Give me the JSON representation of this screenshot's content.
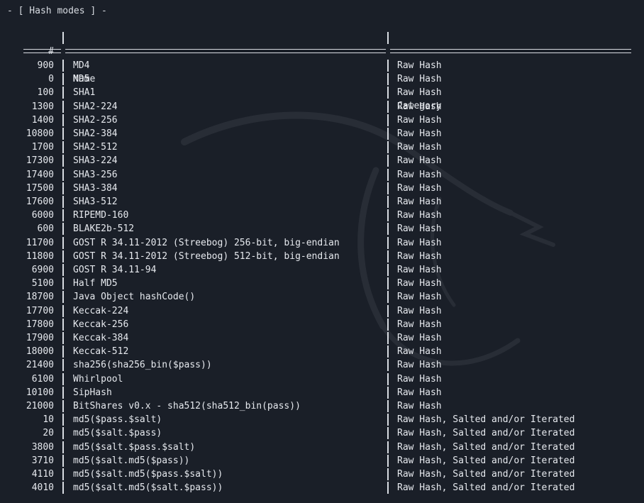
{
  "title": "- [ Hash modes ] -",
  "columns": {
    "num": "#",
    "name": "Name",
    "category": "Category"
  },
  "rows": [
    {
      "num": "900",
      "name": "MD4",
      "category": "Raw Hash"
    },
    {
      "num": "0",
      "name": "MD5",
      "category": "Raw Hash"
    },
    {
      "num": "100",
      "name": "SHA1",
      "category": "Raw Hash"
    },
    {
      "num": "1300",
      "name": "SHA2-224",
      "category": "Raw Hash"
    },
    {
      "num": "1400",
      "name": "SHA2-256",
      "category": "Raw Hash"
    },
    {
      "num": "10800",
      "name": "SHA2-384",
      "category": "Raw Hash"
    },
    {
      "num": "1700",
      "name": "SHA2-512",
      "category": "Raw Hash"
    },
    {
      "num": "17300",
      "name": "SHA3-224",
      "category": "Raw Hash"
    },
    {
      "num": "17400",
      "name": "SHA3-256",
      "category": "Raw Hash"
    },
    {
      "num": "17500",
      "name": "SHA3-384",
      "category": "Raw Hash"
    },
    {
      "num": "17600",
      "name": "SHA3-512",
      "category": "Raw Hash"
    },
    {
      "num": "6000",
      "name": "RIPEMD-160",
      "category": "Raw Hash"
    },
    {
      "num": "600",
      "name": "BLAKE2b-512",
      "category": "Raw Hash"
    },
    {
      "num": "11700",
      "name": "GOST R 34.11-2012 (Streebog) 256-bit, big-endian",
      "category": "Raw Hash"
    },
    {
      "num": "11800",
      "name": "GOST R 34.11-2012 (Streebog) 512-bit, big-endian",
      "category": "Raw Hash"
    },
    {
      "num": "6900",
      "name": "GOST R 34.11-94",
      "category": "Raw Hash"
    },
    {
      "num": "5100",
      "name": "Half MD5",
      "category": "Raw Hash"
    },
    {
      "num": "18700",
      "name": "Java Object hashCode()",
      "category": "Raw Hash"
    },
    {
      "num": "17700",
      "name": "Keccak-224",
      "category": "Raw Hash"
    },
    {
      "num": "17800",
      "name": "Keccak-256",
      "category": "Raw Hash"
    },
    {
      "num": "17900",
      "name": "Keccak-384",
      "category": "Raw Hash"
    },
    {
      "num": "18000",
      "name": "Keccak-512",
      "category": "Raw Hash"
    },
    {
      "num": "21400",
      "name": "sha256(sha256_bin($pass))",
      "category": "Raw Hash"
    },
    {
      "num": "6100",
      "name": "Whirlpool",
      "category": "Raw Hash"
    },
    {
      "num": "10100",
      "name": "SipHash",
      "category": "Raw Hash"
    },
    {
      "num": "21000",
      "name": "BitShares v0.x - sha512(sha512_bin(pass))",
      "category": "Raw Hash"
    },
    {
      "num": "10",
      "name": "md5($pass.$salt)",
      "category": "Raw Hash, Salted and/or Iterated"
    },
    {
      "num": "20",
      "name": "md5($salt.$pass)",
      "category": "Raw Hash, Salted and/or Iterated"
    },
    {
      "num": "3800",
      "name": "md5($salt.$pass.$salt)",
      "category": "Raw Hash, Salted and/or Iterated"
    },
    {
      "num": "3710",
      "name": "md5($salt.md5($pass))",
      "category": "Raw Hash, Salted and/or Iterated"
    },
    {
      "num": "4110",
      "name": "md5($salt.md5($pass.$salt))",
      "category": "Raw Hash, Salted and/or Iterated"
    },
    {
      "num": "4010",
      "name": "md5($salt.md5($salt.$pass))",
      "category": "Raw Hash, Salted and/or Iterated"
    }
  ],
  "colors": {
    "background": "#1a1f28",
    "text": "#e6e9ee",
    "logo": "#3a3f48"
  },
  "background_logo": "kali-dragon-icon"
}
